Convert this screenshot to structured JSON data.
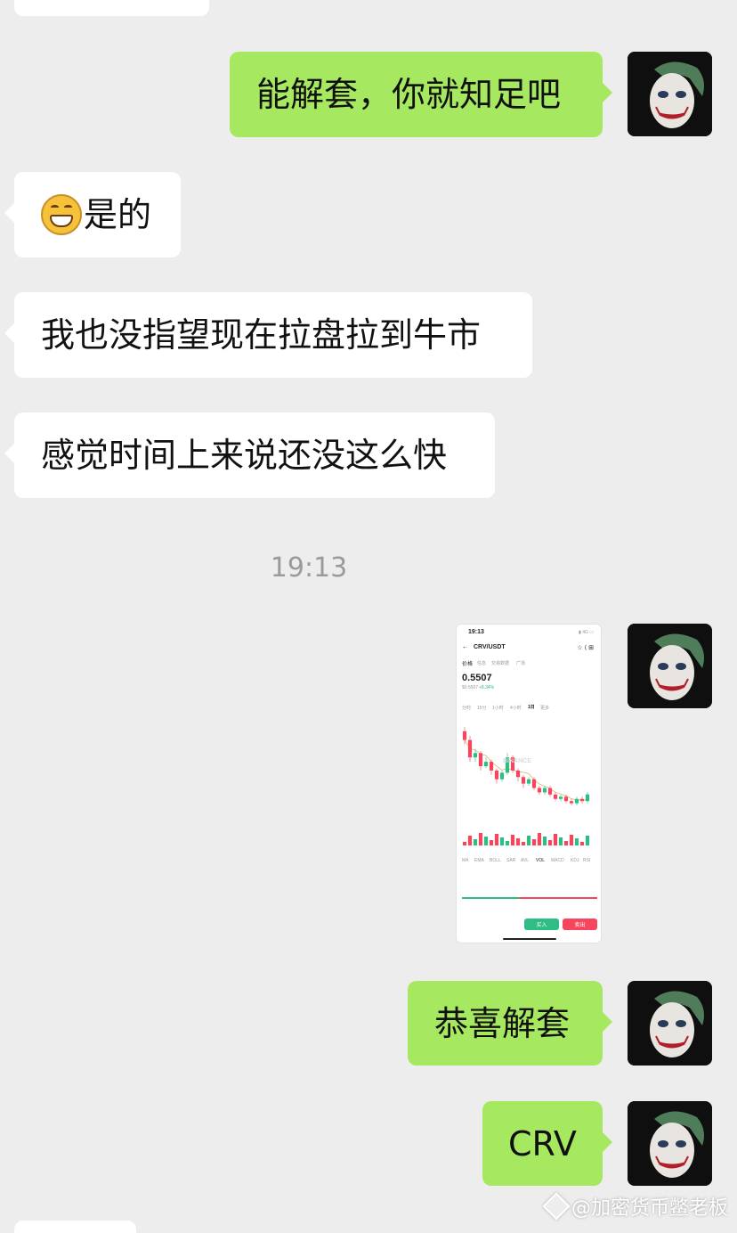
{
  "messages": [
    {
      "side": "right",
      "text": "能解套，你就知足吧"
    },
    {
      "side": "left",
      "emoji": "grinning-face",
      "text": "是的"
    },
    {
      "side": "left",
      "text": "我也没指望现在拉盘拉到牛市"
    },
    {
      "side": "left",
      "text": "感觉时间上来说还没这么快"
    },
    {
      "side": "right",
      "text": "恭喜解套"
    },
    {
      "side": "right",
      "text": "CRV"
    }
  ],
  "timestamp": "19:13",
  "screenshot": {
    "status_time": "19:13",
    "pair": "CRV/USDT",
    "tabs": [
      "价格",
      "信息",
      "交易数据",
      "广场"
    ],
    "price": "0.5507",
    "price_usd": "$0.5507",
    "change": "+8.34%",
    "intervals": [
      "分时",
      "15分",
      "1小时",
      "4小时",
      "1日",
      "更多"
    ],
    "watermark": "BINANCE",
    "indicators": [
      "MA",
      "EMA",
      "BOLL",
      "SAR",
      "AVL",
      "VOL",
      "MACD",
      "KDJ",
      "RSI"
    ],
    "buy_label": "买入",
    "sell_label": "卖出",
    "candles": [
      [
        0.84,
        0.8,
        0.86,
        0.78
      ],
      [
        0.8,
        0.72,
        0.82,
        0.7
      ],
      [
        0.72,
        0.74,
        0.76,
        0.7
      ],
      [
        0.74,
        0.68,
        0.75,
        0.66
      ],
      [
        0.68,
        0.7,
        0.72,
        0.67
      ],
      [
        0.7,
        0.66,
        0.71,
        0.64
      ],
      [
        0.66,
        0.62,
        0.67,
        0.6
      ],
      [
        0.62,
        0.65,
        0.66,
        0.61
      ],
      [
        0.65,
        0.72,
        0.74,
        0.64
      ],
      [
        0.72,
        0.66,
        0.73,
        0.65
      ],
      [
        0.66,
        0.63,
        0.67,
        0.61
      ],
      [
        0.63,
        0.6,
        0.64,
        0.58
      ],
      [
        0.6,
        0.62,
        0.63,
        0.59
      ],
      [
        0.62,
        0.58,
        0.63,
        0.57
      ],
      [
        0.58,
        0.56,
        0.59,
        0.55
      ],
      [
        0.56,
        0.58,
        0.59,
        0.55
      ],
      [
        0.58,
        0.55,
        0.59,
        0.54
      ],
      [
        0.55,
        0.53,
        0.56,
        0.52
      ],
      [
        0.53,
        0.54,
        0.55,
        0.52
      ],
      [
        0.54,
        0.52,
        0.55,
        0.51
      ],
      [
        0.52,
        0.51,
        0.53,
        0.5
      ],
      [
        0.51,
        0.53,
        0.54,
        0.5
      ],
      [
        0.53,
        0.52,
        0.54,
        0.51
      ],
      [
        0.52,
        0.5507,
        0.56,
        0.51
      ]
    ]
  },
  "watermark_text": "@加密货币鳖老板",
  "colors": {
    "bubble_right": "#a6e860",
    "bubble_left": "#ffffff",
    "background": "#ededed",
    "up": "#2ebd85",
    "down": "#f6465d"
  }
}
